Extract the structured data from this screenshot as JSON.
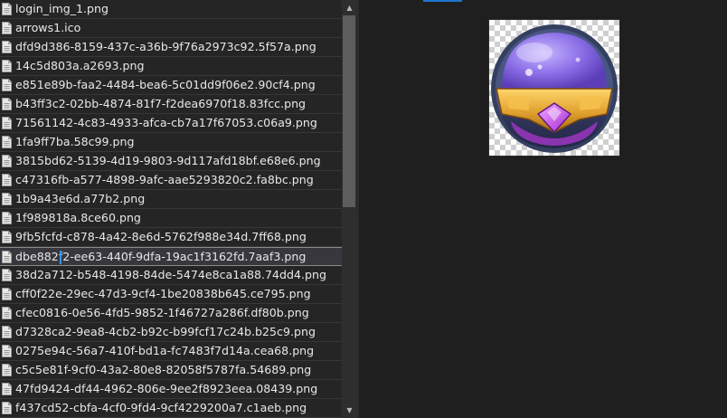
{
  "files": [
    {
      "name": "login_img_1.png",
      "icon": "png-file-icon"
    },
    {
      "name": "arrows1.ico",
      "icon": "ico-file-icon"
    },
    {
      "name": "dfd9d386-8159-437c-a36b-9f76a2973c92.5f57a.png",
      "icon": "png-file-icon"
    },
    {
      "name": "14c5d803a.a2693.png",
      "icon": "png-file-icon"
    },
    {
      "name": "e851e89b-faa2-4484-bea6-5c01dd9f06e2.90cf4.png",
      "icon": "png-file-icon"
    },
    {
      "name": "b43ff3c2-02bb-4874-81f7-f2dea6970f18.83fcc.png",
      "icon": "png-file-icon"
    },
    {
      "name": "71561142-4c83-4933-afca-cb7a17f67053.c06a9.png",
      "icon": "png-file-icon"
    },
    {
      "name": "1fa9ff7ba.58c99.png",
      "icon": "png-file-icon"
    },
    {
      "name": "3815bd62-5139-4d19-9803-9d117afd18bf.e68e6.png",
      "icon": "png-file-icon"
    },
    {
      "name": "c47316fb-a577-4898-9afc-aae5293820c2.fa8bc.png",
      "icon": "png-file-icon"
    },
    {
      "name": "1b9a43e6d.a77b2.png",
      "icon": "png-file-icon"
    },
    {
      "name": "1f989818a.8ce60.png",
      "icon": "png-file-icon"
    },
    {
      "name": "9fb5fcfd-c878-4a42-8e6d-5762f988e34d.7ff68.png",
      "icon": "png-file-icon"
    },
    {
      "name": "dbe882f2-ee63-440f-9dfa-19ac1f3162fd.7aaf3.png",
      "icon": "png-file-icon",
      "selected": true
    },
    {
      "name": "38d2a712-b548-4198-84de-5474e8ca1a88.74dd4.png",
      "icon": "png-file-icon"
    },
    {
      "name": "cff0f22e-29ec-47d3-9cf4-1be20838b645.ce795.png",
      "icon": "png-file-icon"
    },
    {
      "name": "cfec0816-0e56-4fd5-9852-1f46727a286f.df80b.png",
      "icon": "png-file-icon"
    },
    {
      "name": "d7328ca2-9ea8-4cb2-b92c-b99fcf17c24b.b25c9.png",
      "icon": "png-file-icon"
    },
    {
      "name": "0275e94c-56a7-410f-bd1a-fc7483f7d14a.cea68.png",
      "icon": "png-file-icon"
    },
    {
      "name": "c5c5e81f-9cf0-43a2-80e8-82058f5787fa.54689.png",
      "icon": "png-file-icon"
    },
    {
      "name": "47fd9424-df44-4962-806e-9ee2f8923eea.08439.png",
      "icon": "png-file-icon"
    },
    {
      "name": "f437cd52-cbfa-4cf0-9fd4-9cf4229200a7.c1aeb.png",
      "icon": "png-file-icon"
    }
  ],
  "colors": {
    "pane_background": "#252526",
    "preview_background": "#1f1f1f",
    "selection_background": "#37373d",
    "text": "#e8e8e8",
    "caret": "#3794ff",
    "tab_accent": "#1f73cc"
  },
  "scrollbar": {
    "up_icon": "scroll-up-arrow-icon",
    "down_icon": "scroll-down-arrow-icon",
    "up_glyph": "▲",
    "down_glyph": "▼"
  },
  "preview": {
    "image_icon": "purple-orb-badge-icon"
  }
}
